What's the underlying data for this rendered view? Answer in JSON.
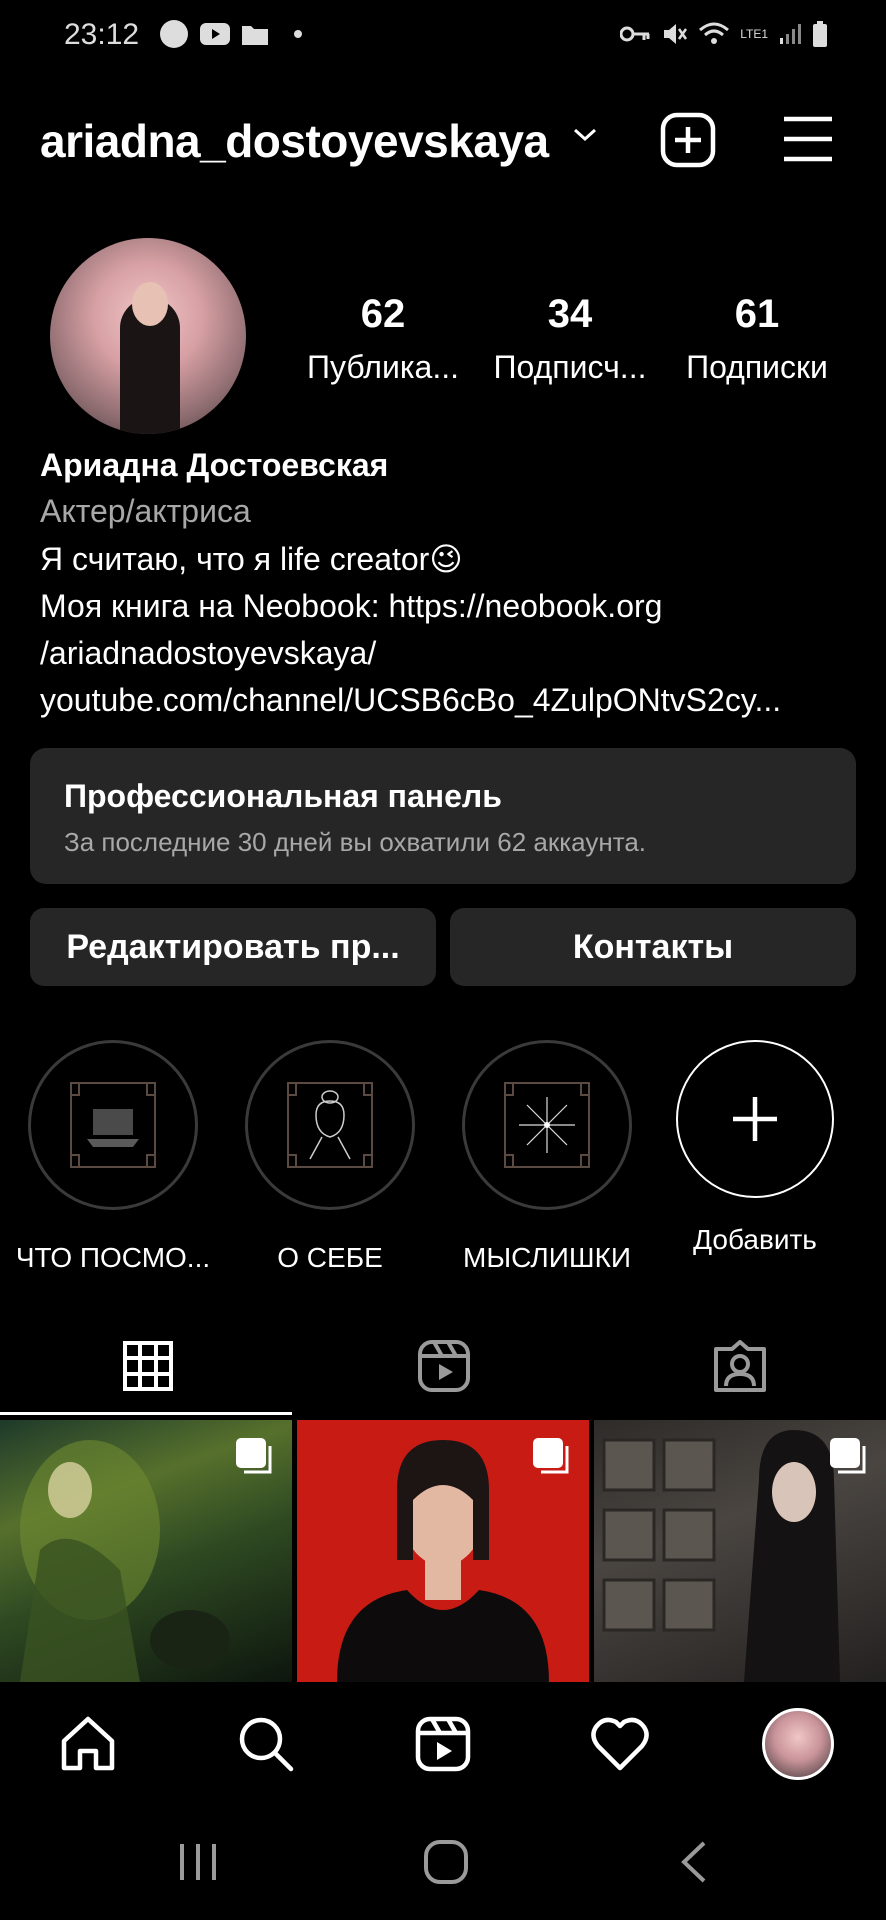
{
  "status_bar": {
    "time": "23:12",
    "network": "LTE1"
  },
  "header": {
    "username": "ariadna_dostoyevskaya"
  },
  "stats": [
    {
      "value": "62",
      "label": "Публика..."
    },
    {
      "value": "34",
      "label": "Подписч..."
    },
    {
      "value": "61",
      "label": "Подписки"
    }
  ],
  "bio": {
    "name": "Ариадна Достоевская",
    "category": "Актер/актриса",
    "lines": [
      "Я считаю, что я life creator😉",
      "Моя книга на Neobook: https://neobook.org",
      "/ariadnadostoyevskaya/",
      "youtube.com/channel/UCSB6cBo_4ZulpONtvS2cy..."
    ]
  },
  "pro_panel": {
    "title": "Профессиональная панель",
    "subtitle": "За последние 30 дней вы охватили 62 аккаунта."
  },
  "buttons": {
    "edit": "Редактировать пр...",
    "contacts": "Контакты"
  },
  "highlights": [
    {
      "label": "ЧТО ПОСМО...",
      "icon": "laptop-icon"
    },
    {
      "label": "О СЕБЕ",
      "icon": "portrait-sketch-icon"
    },
    {
      "label": "МЫСЛИШКИ",
      "icon": "sparkle-icon"
    },
    {
      "label": "Добавить",
      "icon": "plus-icon"
    }
  ],
  "tabs": [
    "grid-icon",
    "reels-icon",
    "tagged-icon"
  ],
  "bottom_nav": [
    "home-icon",
    "search-icon",
    "reels-icon",
    "heart-icon",
    "profile-avatar"
  ],
  "colors": {
    "background": "#000000",
    "panel": "#262626",
    "secondary_text": "#a8a8a8"
  }
}
